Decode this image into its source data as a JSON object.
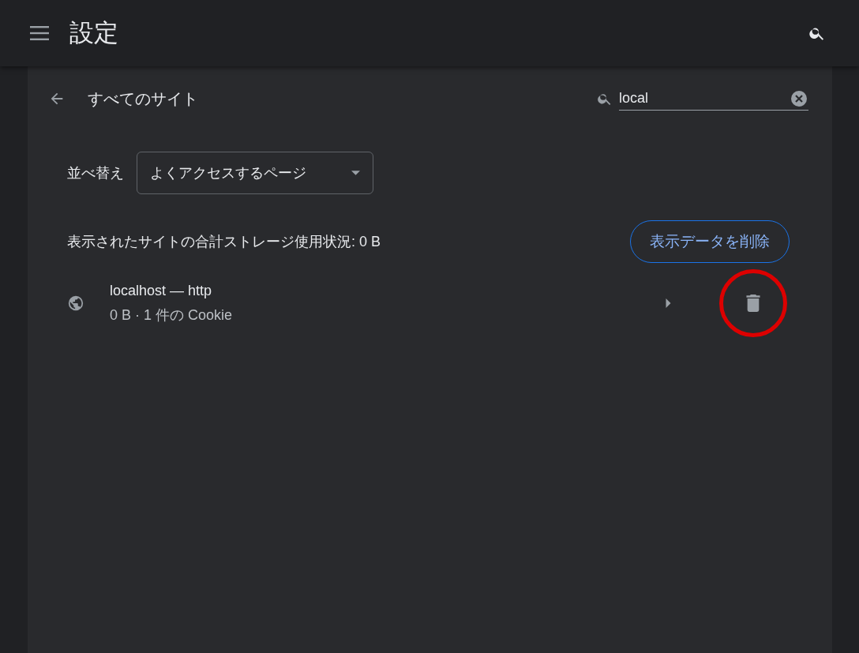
{
  "header": {
    "title": "設定"
  },
  "subpage": {
    "title": "すべてのサイト",
    "search": {
      "value": "local"
    }
  },
  "sort": {
    "label": "並べ替え",
    "value": "よくアクセスするページ"
  },
  "storage": {
    "summary": "表示されたサイトの合計ストレージ使用状況: 0 B",
    "clear_button": "表示データを削除"
  },
  "sites": [
    {
      "name": "localhost — http",
      "details": "0 B · 1 件の Cookie",
      "highlighted": true
    }
  ]
}
